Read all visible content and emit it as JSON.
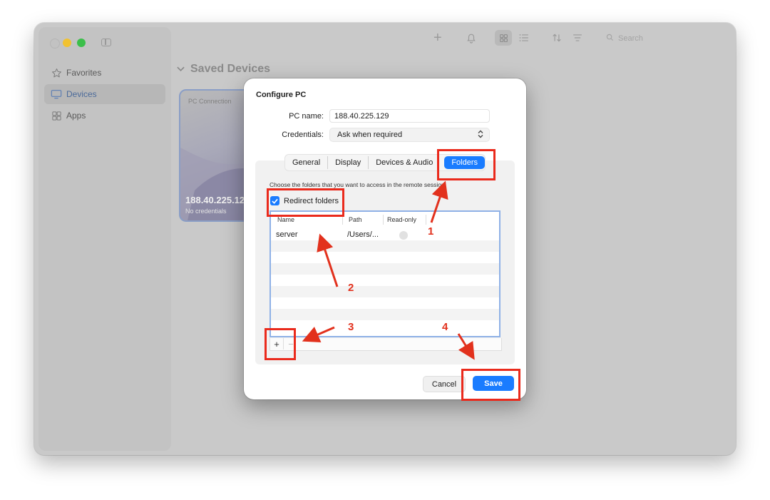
{
  "sidebar": {
    "items": [
      {
        "label": "Favorites",
        "icon": "star-icon"
      },
      {
        "label": "Devices",
        "icon": "monitor-icon",
        "active": true
      },
      {
        "label": "Apps",
        "icon": "apps-grid-icon"
      }
    ]
  },
  "toolbar": {
    "search_placeholder": "Search"
  },
  "main": {
    "section_title": "Saved Devices",
    "device_card": {
      "label": "PC Connection",
      "ip": "188.40.225.12",
      "subtitle": "No credentials"
    }
  },
  "dialog": {
    "title": "Configure PC",
    "pc_name_label": "PC name:",
    "pc_name_value": "188.40.225.129",
    "credentials_label": "Credentials:",
    "credentials_value": "Ask when required",
    "tabs": [
      {
        "label": "General"
      },
      {
        "label": "Display"
      },
      {
        "label": "Devices & Audio"
      },
      {
        "label": "Folders",
        "selected": true
      }
    ],
    "hint": "Choose the folders that you want to access in the remote session.",
    "redirect_label": "Redirect folders",
    "redirect_checked": true,
    "table": {
      "columns": [
        "Name",
        "Path",
        "Read-only"
      ],
      "rows": [
        {
          "name": "server",
          "path": "/Users/...",
          "read_only": false
        }
      ]
    },
    "add_symbol": "+",
    "remove_symbol": "−",
    "cancel_label": "Cancel",
    "save_label": "Save"
  },
  "annotations": {
    "color": "#ea2a1c",
    "numbers": [
      "1",
      "2",
      "3",
      "4"
    ]
  }
}
